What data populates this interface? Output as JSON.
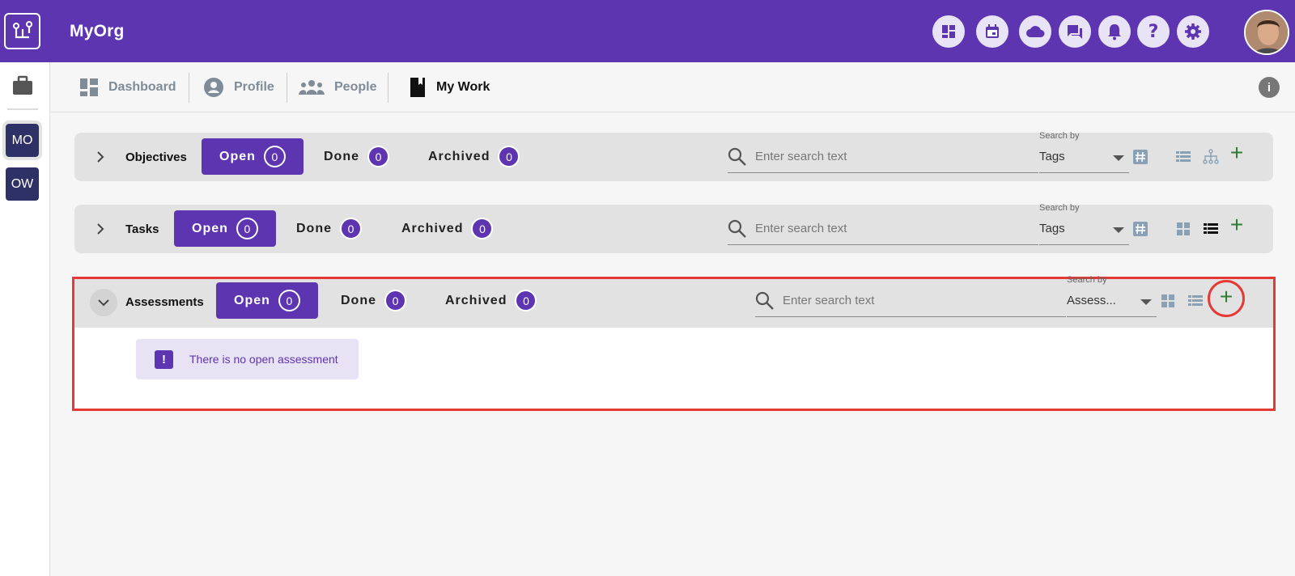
{
  "app": {
    "title": "MyOrg"
  },
  "topbar": {
    "icons": [
      "dashboard-icon",
      "calendar-icon",
      "cloud-icon",
      "chat-icon",
      "bell-icon",
      "help-icon",
      "settings-icon"
    ]
  },
  "leftrail": {
    "items": [
      {
        "label": "MO"
      },
      {
        "label": "OW"
      }
    ]
  },
  "nav": {
    "items": [
      {
        "label": "Dashboard"
      },
      {
        "label": "Profile"
      },
      {
        "label": "People"
      },
      {
        "label": "My Work"
      }
    ]
  },
  "search": {
    "placeholder": "Enter search text",
    "by_label": "Search by"
  },
  "panels": {
    "objectives": {
      "title": "Objectives",
      "tabs": [
        {
          "label": "Open",
          "count": "0"
        },
        {
          "label": "Done",
          "count": "0"
        },
        {
          "label": "Archived",
          "count": "0"
        }
      ],
      "search_by": "Tags"
    },
    "tasks": {
      "title": "Tasks",
      "tabs": [
        {
          "label": "Open",
          "count": "0"
        },
        {
          "label": "Done",
          "count": "0"
        },
        {
          "label": "Archived",
          "count": "0"
        }
      ],
      "search_by": "Tags"
    },
    "assessments": {
      "title": "Assessments",
      "tabs": [
        {
          "label": "Open",
          "count": "0"
        },
        {
          "label": "Done",
          "count": "0"
        },
        {
          "label": "Archived",
          "count": "0"
        }
      ],
      "search_by": "Assess...",
      "empty_message": "There is no open assessment"
    }
  },
  "colors": {
    "brand": "#5e35b1",
    "add": "#2e7d32",
    "highlight": "#e53935"
  }
}
